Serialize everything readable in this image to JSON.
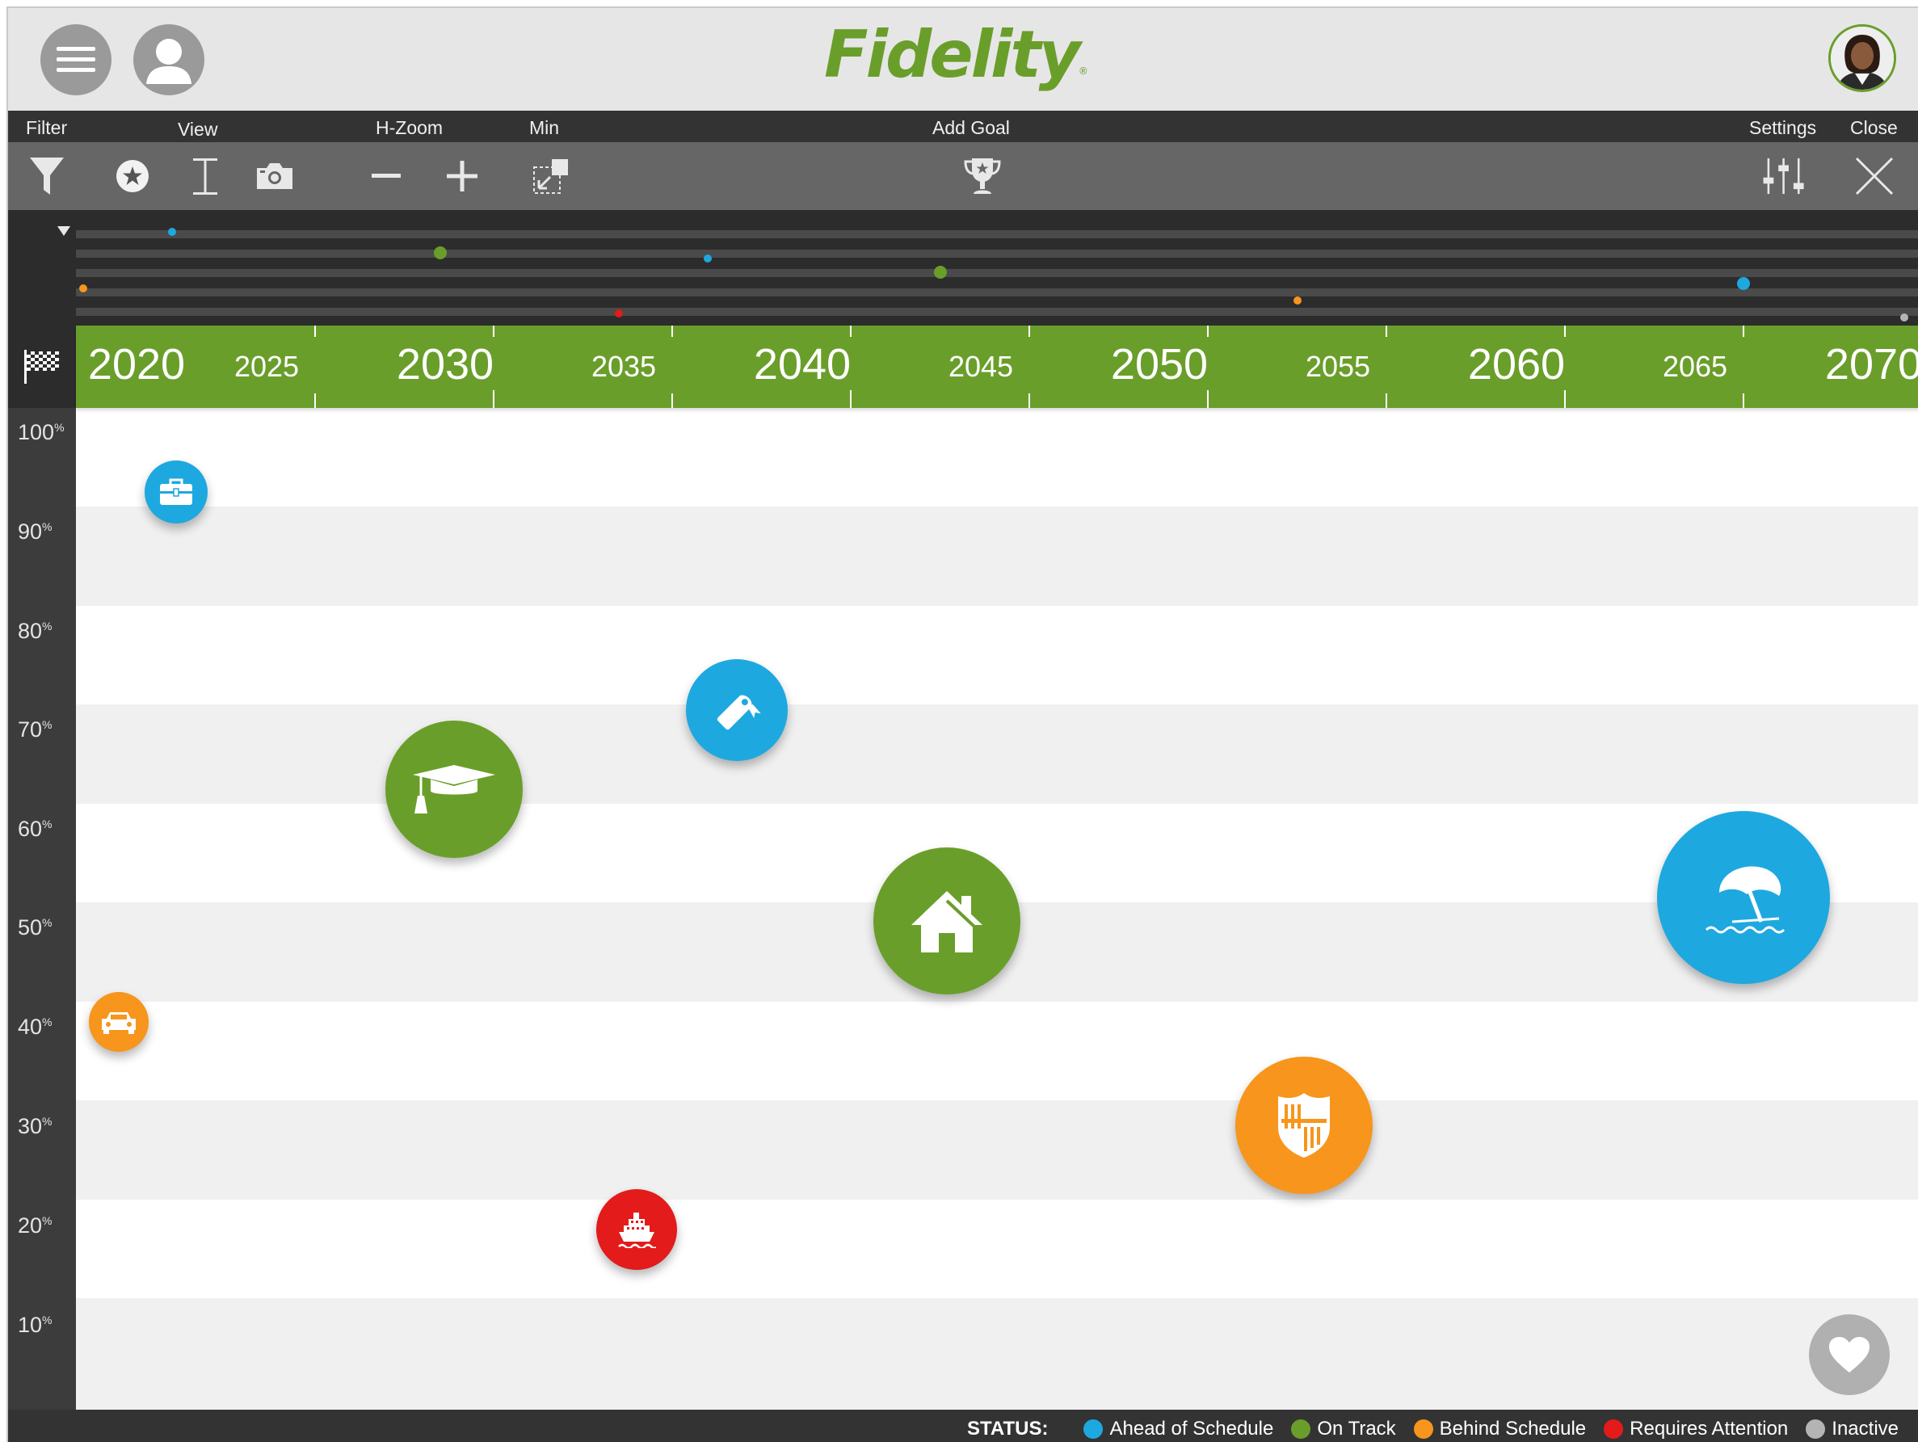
{
  "app": {
    "brand": "Fidelity",
    "trademark": "®"
  },
  "header": {
    "menu_icon": "hamburger-menu-icon",
    "profile_icon": "user-profile-icon"
  },
  "toolbar": {
    "filter_label": "Filter",
    "view_label": "View",
    "hzoom_label": "H-Zoom",
    "min_label": "Min",
    "add_goal_label": "Add Goal",
    "settings_label": "Settings",
    "close_label": "Close"
  },
  "timeline": {
    "major_years": [
      "2020",
      "2030",
      "2040",
      "2050",
      "2060",
      "2070"
    ],
    "minor_years": [
      "2025",
      "2035",
      "2045",
      "2055",
      "2065"
    ],
    "start_icon": "checkered-flag-icon"
  },
  "y_axis": {
    "labels": [
      {
        "value": "100",
        "unit": "%"
      },
      {
        "value": "90",
        "unit": "%"
      },
      {
        "value": "80",
        "unit": "%"
      },
      {
        "value": "70",
        "unit": "%"
      },
      {
        "value": "60",
        "unit": "%"
      },
      {
        "value": "50",
        "unit": "%"
      },
      {
        "value": "40",
        "unit": "%"
      },
      {
        "value": "30",
        "unit": "%"
      },
      {
        "value": "20",
        "unit": "%"
      },
      {
        "value": "10",
        "unit": "%"
      }
    ]
  },
  "colors": {
    "ahead": "#1ea8e0",
    "on_track": "#6a9e2a",
    "behind": "#f7951c",
    "attention": "#e31b1b",
    "inactive": "#b4b4b4",
    "brand_green": "#6a9e2a"
  },
  "goals": [
    {
      "icon": "briefcase-icon",
      "status": "ahead",
      "year": 2021.1,
      "progress": 91.5
    },
    {
      "icon": "graduation-cap-icon",
      "status": "on_track",
      "year": 2028.9,
      "progress": 61.5
    },
    {
      "icon": "diploma-icon",
      "status": "ahead",
      "year": 2036.8,
      "progress": 69.5
    },
    {
      "icon": "house-icon",
      "status": "on_track",
      "year": 2042.7,
      "progress": 48.2
    },
    {
      "icon": "umbrella-beach-icon",
      "status": "ahead",
      "year": 2065.0,
      "progress": 50.5
    },
    {
      "icon": "car-icon",
      "status": "behind",
      "year": 2019.5,
      "progress": 38.0
    },
    {
      "icon": "shield-icon",
      "status": "behind",
      "year": 2052.7,
      "progress": 27.5
    },
    {
      "icon": "cruise-ship-icon",
      "status": "attention",
      "year": 2034.0,
      "progress": 17.0
    }
  ],
  "overview_markers": [
    {
      "status": "ahead",
      "year": 2021.0
    },
    {
      "status": "on_track",
      "year": 2028.5
    },
    {
      "status": "ahead",
      "year": 2036.0
    },
    {
      "status": "on_track",
      "year": 2042.5
    },
    {
      "status": "ahead",
      "year": 2065.0
    },
    {
      "status": "behind",
      "year": 2018.5
    },
    {
      "status": "behind",
      "year": 2052.5
    },
    {
      "status": "attention",
      "year": 2033.5
    },
    {
      "status": "inactive",
      "year": 2069.5
    }
  ],
  "status_legend": {
    "title": "STATUS:",
    "items": [
      {
        "key": "ahead",
        "label": "Ahead of Schedule"
      },
      {
        "key": "on_track",
        "label": "On Track"
      },
      {
        "key": "behind",
        "label": "Behind Schedule"
      },
      {
        "key": "attention",
        "label": "Requires Attention"
      },
      {
        "key": "inactive",
        "label": "Inactive"
      }
    ]
  },
  "favorite_icon": "heart-icon"
}
